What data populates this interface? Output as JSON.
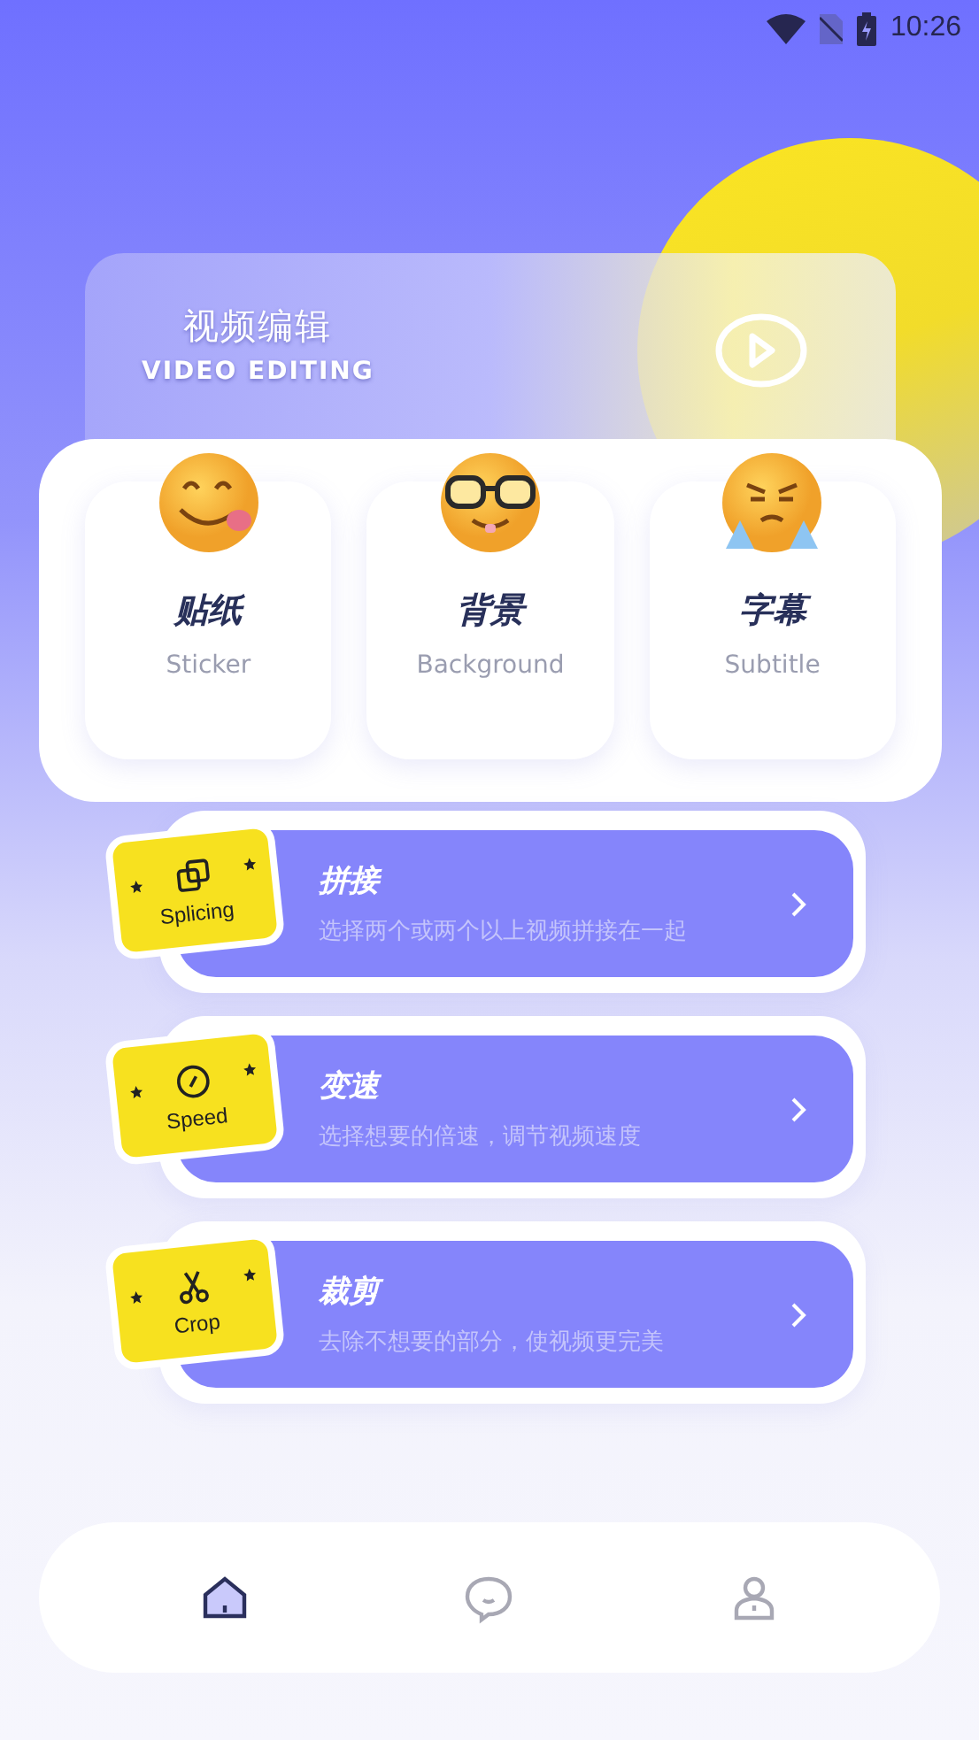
{
  "status_bar": {
    "time": "10:26"
  },
  "header": {
    "title": "视频编辑",
    "subtitle": "VIDEO EDITING"
  },
  "features": [
    {
      "kind": "tongue",
      "title": "贴纸",
      "subtitle": "Sticker"
    },
    {
      "kind": "glasses",
      "title": "背景",
      "subtitle": "Background"
    },
    {
      "kind": "steam",
      "title": "字幕",
      "subtitle": "Subtitle"
    }
  ],
  "tools": [
    {
      "kind": "splice",
      "badge": "Splicing",
      "title": "拼接",
      "description": "选择两个或两个以上视频拼接在一起"
    },
    {
      "kind": "speed",
      "badge": "Speed",
      "title": "变速",
      "description": "选择想要的倍速，调节视频速度"
    },
    {
      "kind": "crop",
      "badge": "Crop",
      "title": "裁剪",
      "description": "去除不想要的部分，使视频更完美"
    }
  ],
  "nav": [
    {
      "kind": "home",
      "selected": true
    },
    {
      "kind": "chat",
      "selected": false
    },
    {
      "kind": "profile",
      "selected": false
    }
  ]
}
